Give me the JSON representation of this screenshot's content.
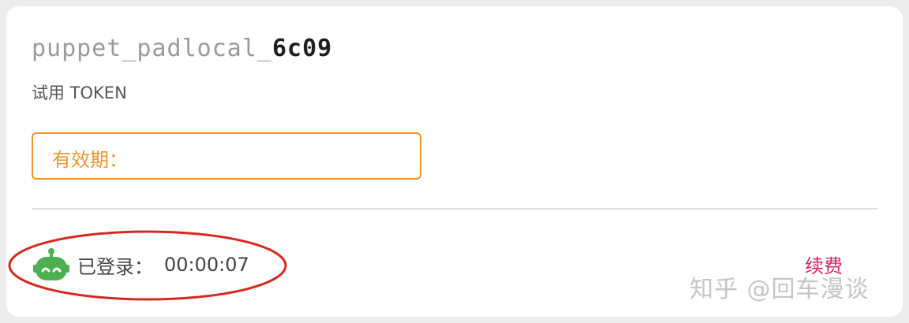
{
  "token": {
    "name_prefix": "puppet_padlocal_",
    "name_suffix": "6c09",
    "type_label": "试用 TOKEN"
  },
  "validity": {
    "label": "有效期："
  },
  "status": {
    "label": "已登录：",
    "duration": "00:00:07",
    "icon": "robot-icon",
    "icon_color": "#4caf50"
  },
  "actions": {
    "renew_label": "续费",
    "renew_color": "#d6245f"
  },
  "watermark": {
    "text": "知乎 @回车漫谈"
  },
  "colors": {
    "accent": "#f0962a",
    "annotation": "#d42a1f"
  }
}
